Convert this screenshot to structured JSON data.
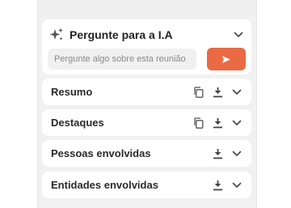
{
  "ai": {
    "title": "Pergunte para a I.A",
    "input_placeholder": "Pergunte algo sobre esta reunião",
    "input_value": "",
    "send_icon": "send-arrow-icon",
    "accent_color": "#ea6a43"
  },
  "sections": [
    {
      "label": "Resumo",
      "icons": [
        "copy-icon",
        "download-icon",
        "chevron-down-icon"
      ]
    },
    {
      "label": "Destaques",
      "icons": [
        "copy-icon",
        "download-icon",
        "chevron-down-icon"
      ]
    },
    {
      "label": "Pessoas envolvidas",
      "icons": [
        "download-icon",
        "chevron-down-icon"
      ]
    },
    {
      "label": "Entidades envolvidas",
      "icons": [
        "download-icon",
        "chevron-down-icon"
      ]
    }
  ]
}
